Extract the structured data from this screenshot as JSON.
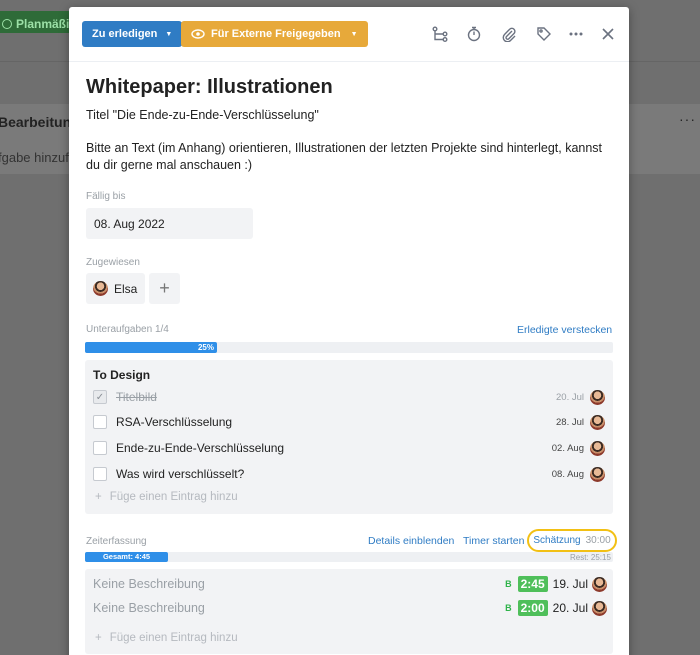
{
  "background": {
    "tag_label": "Planmäßig",
    "heading": "Bearbeitung(",
    "sub": "fgabe hinzufü",
    "dots": "···"
  },
  "toolbar": {
    "status_label": "Zu erledigen",
    "share_label": "Für Externe Freigegeben",
    "icons": [
      "subtasks-icon",
      "timer-icon",
      "attachment-icon",
      "tag-icon",
      "more-icon",
      "close-icon"
    ]
  },
  "task": {
    "title": "Whitepaper: Illustrationen",
    "description_line1": "Titel \"Die Ende-zu-Ende-Verschlüsselung\"",
    "description_line2": "Bitte an Text (im Anhang) orientieren, Illustrationen der letzten Projekte sind hinterlegt, kannst du dir gerne mal anschauen :)"
  },
  "due": {
    "label": "Fällig bis",
    "value": "08. Aug 2022"
  },
  "assigned": {
    "label": "Zugewiesen",
    "name": "Elsa",
    "add_symbol": "+"
  },
  "subtasks": {
    "label": "Unteraufgaben 1/4",
    "hide_link": "Erledigte verstecken",
    "progress_percent": 25,
    "progress_label": "25%",
    "checklist_title": "To Design",
    "items": [
      {
        "text": "Titelbild",
        "date": "20. Jul",
        "done": true
      },
      {
        "text": "RSA-Verschlüsselung",
        "date": "28. Jul",
        "done": false
      },
      {
        "text": "Ende-zu-Ende-Verschlüsselung",
        "date": "02. Aug",
        "done": false
      },
      {
        "text": "Was wird verschlüsselt?",
        "date": "08. Aug",
        "done": false
      }
    ],
    "add_placeholder": "Füge einen Eintrag hinzu"
  },
  "time_tracking": {
    "label": "Zeiterfassung",
    "details_link": "Details einblenden",
    "timer_link": "Timer starten",
    "estimate_label": "Schätzung",
    "estimate_value": "30:00",
    "total_label": "Gesamt: 4:45",
    "rest_label": "Rest: 25:15",
    "entries": [
      {
        "description": "Keine Beschreibung",
        "badge": "B",
        "duration": "2:45",
        "date": "19. Jul"
      },
      {
        "description": "Keine Beschreibung",
        "badge": "B",
        "duration": "2:00",
        "date": "20. Jul"
      }
    ],
    "add_placeholder": "Füge einen Eintrag hinzu"
  },
  "colors": {
    "status_blue": "#2f7cc4",
    "share_orange": "#e7a93a",
    "progress_blue": "#2f8fe8",
    "duration_green": "#4fbf5a",
    "estimate_highlight": "#f2c014"
  }
}
